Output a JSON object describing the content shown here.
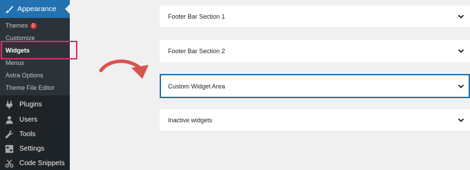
{
  "sidebar": {
    "appearance": {
      "label": "Appearance"
    },
    "submenu": {
      "themes": {
        "label": "Themes",
        "badge": "2"
      },
      "customize": {
        "label": "Customize"
      },
      "widgets": {
        "label": "Widgets"
      },
      "menus": {
        "label": "Menus"
      },
      "astra_options": {
        "label": "Astra Options"
      },
      "theme_file_editor": {
        "label": "Theme File Editor"
      }
    },
    "items": [
      {
        "label": "Plugins",
        "icon": "plug-icon"
      },
      {
        "label": "Users",
        "icon": "user-icon"
      },
      {
        "label": "Tools",
        "icon": "wrench-icon"
      },
      {
        "label": "Settings",
        "icon": "settings-icon"
      },
      {
        "label": "Code Snippets",
        "icon": "scissors-icon"
      }
    ]
  },
  "widget_areas": [
    {
      "title": "Footer Bar Section 1"
    },
    {
      "title": "Footer Bar Section 2"
    },
    {
      "title": "Custom Widget Area"
    },
    {
      "title": "Inactive widgets"
    }
  ],
  "colors": {
    "sidebar_bg": "#1d2327",
    "active_menu": "#2271b1",
    "highlight": "#d1306b",
    "arrow": "#d9534f"
  }
}
